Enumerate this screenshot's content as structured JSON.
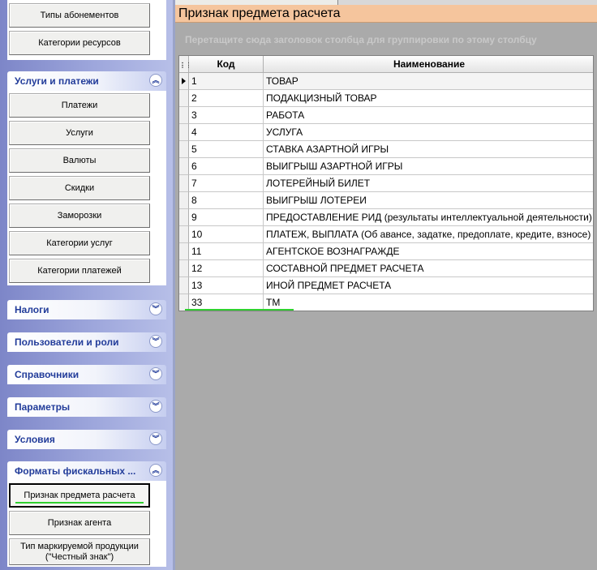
{
  "sidebar": {
    "top_group": {
      "buttons": [
        "Типы абонементов",
        "Категории ресурсов"
      ]
    },
    "services": {
      "title": "Услуги и платежи",
      "chevron": "chevron-up-icon",
      "buttons": [
        "Платежи",
        "Услуги",
        "Валюты",
        "Скидки",
        "Заморозки",
        "Категории услуг",
        "Категории платежей"
      ]
    },
    "collapsed": [
      {
        "title": "Налоги",
        "chevron": "chevron-down-icon"
      },
      {
        "title": "Пользователи и роли",
        "chevron": "chevron-down-icon"
      },
      {
        "title": "Справочники",
        "chevron": "chevron-down-icon"
      },
      {
        "title": "Параметры",
        "chevron": "chevron-down-icon"
      },
      {
        "title": "Условия",
        "chevron": "chevron-down-icon"
      }
    ],
    "fiscal": {
      "title": "Форматы фискальных ...",
      "chevron": "chevron-up-icon",
      "buttons": [
        "Признак предмета расчета",
        "Признак агента",
        "Тип маркируемой продукции (\"Честный знак\")"
      ],
      "active_index": 0
    }
  },
  "main": {
    "title": "Признак предмета расчета",
    "group_hint": "Перетащите сюда заголовок столбца для группировки по этому столбцу",
    "columns": [
      "Код",
      "Наименование"
    ],
    "rows": [
      {
        "code": "1",
        "name": "ТОВАР"
      },
      {
        "code": "2",
        "name": "ПОДАКЦИЗНЫЙ ТОВАР"
      },
      {
        "code": "3",
        "name": "РАБОТА"
      },
      {
        "code": "4",
        "name": "УСЛУГА"
      },
      {
        "code": "5",
        "name": "СТАВКА АЗАРТНОЙ ИГРЫ"
      },
      {
        "code": "6",
        "name": "ВЫИГРЫШ АЗАРТНОЙ ИГРЫ"
      },
      {
        "code": "7",
        "name": "ЛОТЕРЕЙНЫЙ БИЛЕТ"
      },
      {
        "code": "8",
        "name": "ВЫИГРЫШ ЛОТЕРЕИ"
      },
      {
        "code": "9",
        "name": "ПРЕДОСТАВЛЕНИЕ РИД (результаты интеллектуальной деятельности)"
      },
      {
        "code": "10",
        "name": "ПЛАТЕЖ, ВЫПЛАТА (Об авансе, задатке, предоплате, кредите, взносе)"
      },
      {
        "code": "11",
        "name": "АГЕНТСКОЕ ВОЗНАГРАЖДЕ"
      },
      {
        "code": "12",
        "name": "СОСТАВНОЙ ПРЕДМЕТ РАСЧЕТА"
      },
      {
        "code": "13",
        "name": "ИНОЙ ПРЕДМЕТ РАСЧЕТА"
      },
      {
        "code": "33",
        "name": "ТМ"
      }
    ],
    "selected_row": 0
  }
}
